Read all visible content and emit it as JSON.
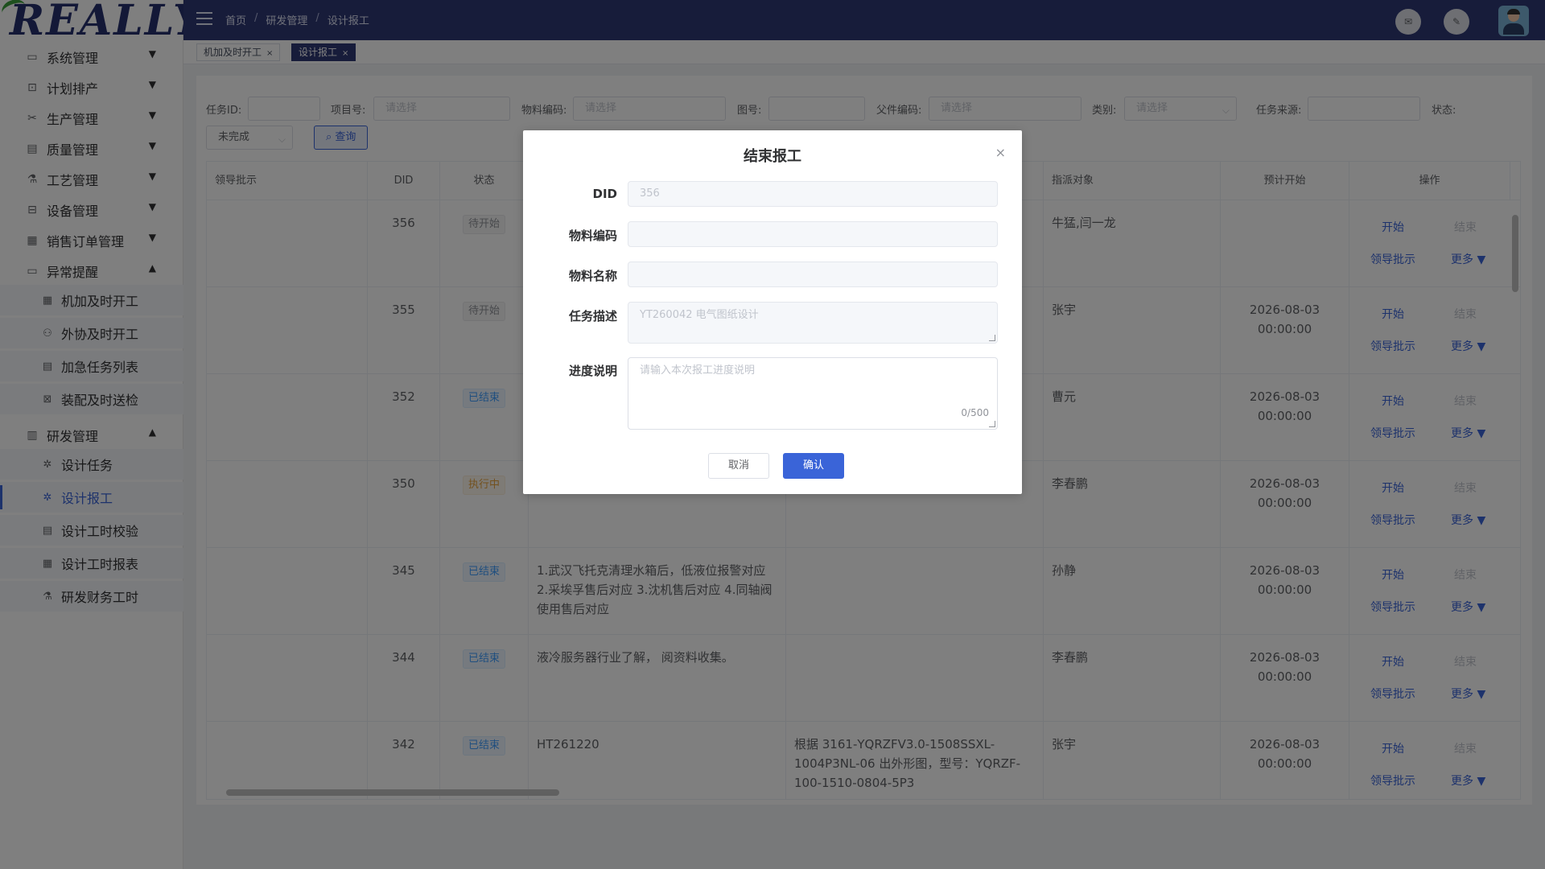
{
  "logo": {
    "text": "REALLY"
  },
  "header": {
    "breadcrumb": [
      "首页",
      "研发管理",
      "设计报工"
    ],
    "mail_icon": "mail-icon",
    "edit_icon": "edit-icon"
  },
  "tags": [
    {
      "label": "机加及时开工",
      "active": false
    },
    {
      "label": "设计报工",
      "active": true
    }
  ],
  "sidebar": {
    "menus": [
      {
        "label": "系统管理",
        "icon": "monitor-icon",
        "expanded": false
      },
      {
        "label": "计划排产",
        "icon": "plan-icon",
        "expanded": false
      },
      {
        "label": "生产管理",
        "icon": "tools-icon",
        "expanded": false
      },
      {
        "label": "质量管理",
        "icon": "document-icon",
        "expanded": false
      },
      {
        "label": "工艺管理",
        "icon": "flask-icon",
        "expanded": false
      },
      {
        "label": "设备管理",
        "icon": "equipment-icon",
        "expanded": false
      },
      {
        "label": "销售订单管理",
        "icon": "order-icon",
        "expanded": false
      },
      {
        "label": "异常提醒",
        "icon": "monitor-icon",
        "expanded": true
      },
      {
        "label": "研发管理",
        "icon": "calendar-icon",
        "expanded": true
      }
    ],
    "abnormal_sub": [
      "机加及时开工",
      "外协及时开工",
      "加急任务列表",
      "装配及时送检"
    ],
    "rd_sub": [
      "设计任务",
      "设计报工",
      "设计工时校验",
      "设计工时报表",
      "研发财务工时"
    ]
  },
  "filters": {
    "task_id_label": "任务ID:",
    "project_label": "项目号:",
    "project_placeholder": "请选择",
    "material_code_label": "物料编码:",
    "material_code_placeholder": "请选择",
    "drawing_label": "图号:",
    "parent_code_label": "父件编码:",
    "parent_code_placeholder": "请选择",
    "category_label": "类别:",
    "category_placeholder": "请选择",
    "source_label": "任务来源:",
    "status_label": "状态:",
    "status_value": "未完成",
    "query_button": "查询"
  },
  "table": {
    "headers": {
      "leader": "领导批示",
      "did": "DID",
      "status": "状态",
      "assignee": "指派对象",
      "planned_start": "预计开始",
      "actions": "操作"
    },
    "rows": [
      {
        "did": "356",
        "status": "待开始",
        "status_type": "wait",
        "desc": "",
        "extra": "",
        "assignee": "牛猛,闫一龙",
        "start_date": "",
        "start_time": ""
      },
      {
        "did": "355",
        "status": "待开始",
        "status_type": "wait",
        "desc": "",
        "extra": "",
        "assignee": "张宇",
        "start_date": "2026-08-03",
        "start_time": "00:00:00"
      },
      {
        "did": "352",
        "status": "已结束",
        "status_type": "end",
        "desc": "",
        "extra": "",
        "assignee": "曹元",
        "start_date": "2026-08-03",
        "start_time": "00:00:00"
      },
      {
        "did": "350",
        "status": "执行中",
        "status_type": "run",
        "desc": "",
        "extra": "",
        "assignee": "李春鹏",
        "start_date": "2026-08-03",
        "start_time": "00:00:00"
      },
      {
        "did": "345",
        "status": "已结束",
        "status_type": "end",
        "desc": "1.武汉飞托克清理水箱后，低液位报警对应 2.采埃孚售后对应 3.沈机售后对应 4.同轴阀使用售后对应",
        "extra": "",
        "assignee": "孙静",
        "start_date": "2026-08-03",
        "start_time": "00:00:00"
      },
      {
        "did": "344",
        "status": "已结束",
        "status_type": "end",
        "desc": "液冷服务器行业了解， 阅资料收集。",
        "extra": "",
        "assignee": "李春鹏",
        "start_date": "2026-08-03",
        "start_time": "00:00:00"
      },
      {
        "did": "342",
        "status": "已结束",
        "status_type": "end",
        "desc": "HT261220",
        "extra": "根据 3161-YQRZFV3.0-1508SSXL-1004P3NL-06 出外形图，型号：YQRZF-100-1510-0804-5P3",
        "assignee": "张宇",
        "start_date": "2026-08-03",
        "start_time": "00:00:00"
      }
    ],
    "action_labels": {
      "start": "开始",
      "end": "结束",
      "leader": "领导批示",
      "more": "更多 ▼"
    }
  },
  "dialog": {
    "title": "结束报工",
    "close": "×",
    "fields": {
      "did_label": "DID",
      "did_value": "356",
      "material_code_label": "物料编码",
      "material_name_label": "物料名称",
      "task_desc_label": "任务描述",
      "task_desc_value": "YT260042 电气图纸设计",
      "progress_label": "进度说明",
      "progress_placeholder": "请输入本次报工进度说明",
      "progress_counter": "0/500"
    },
    "cancel": "取消",
    "confirm": "确认"
  }
}
